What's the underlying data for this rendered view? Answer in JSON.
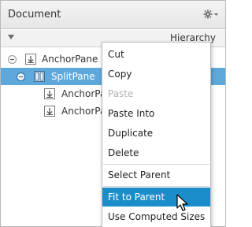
{
  "panel": {
    "title": "Document",
    "settings_icon": "gear-icon",
    "hierarchy_label": "Hierarchy"
  },
  "tree": {
    "rows": [
      {
        "label": "AnchorPane",
        "icon": "anchor-pane-icon",
        "collapsible": true,
        "selected": false
      },
      {
        "label": "SplitPane",
        "icon": "split-pane-icon",
        "collapsible": true,
        "selected": true
      },
      {
        "label": "AnchorPane",
        "icon": "anchor-pane-icon",
        "collapsible": false,
        "selected": false
      },
      {
        "label": "AnchorPane",
        "icon": "anchor-pane-icon",
        "collapsible": false,
        "selected": false
      }
    ]
  },
  "context_menu": {
    "items": [
      {
        "label": "Cut",
        "enabled": true
      },
      {
        "label": "Copy",
        "enabled": true
      },
      {
        "label": "Paste",
        "enabled": false
      },
      {
        "label": "Paste Into",
        "enabled": true
      },
      {
        "label": "Duplicate",
        "enabled": true
      },
      {
        "label": "Delete",
        "enabled": true
      },
      {
        "label": "Select Parent",
        "enabled": true
      },
      {
        "label": "Fit to Parent",
        "enabled": true,
        "highlighted": true
      },
      {
        "label": "Use Computed Sizes",
        "enabled": true
      }
    ]
  },
  "colors": {
    "selected_row": "#5fa8dc",
    "menu_highlight": "#1b8ec9",
    "disabled_text": "#b3b3b3"
  }
}
